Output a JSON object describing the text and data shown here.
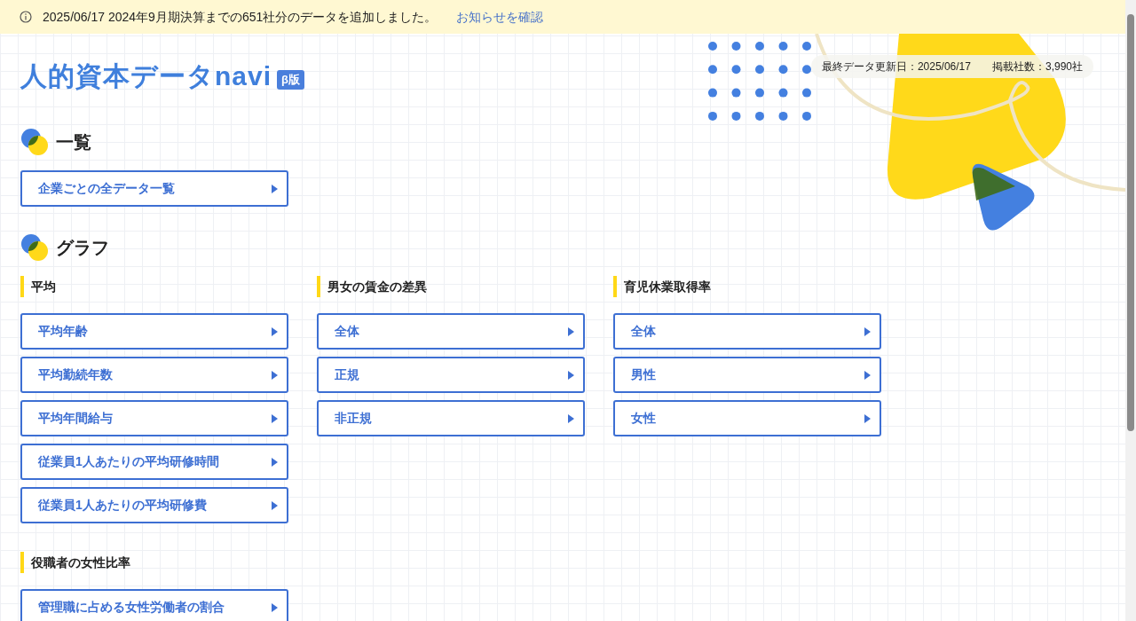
{
  "notice": {
    "text": "2025/06/17 2024年9月期決算までの651社分のデータを追加しました。",
    "link": "お知らせを確認"
  },
  "logo": {
    "text": "人的資本データnavi",
    "badge": "β版"
  },
  "stats": [
    {
      "text": "最終データ更新日：2025/06/17"
    },
    {
      "text": "掲載社数：3,990社"
    }
  ],
  "sections": [
    {
      "title": "一覧",
      "groups": [
        {
          "links": [
            "企業ごとの全データ一覧"
          ]
        }
      ]
    },
    {
      "title": "グラフ",
      "groups": [
        {
          "title": "平均",
          "links": [
            "平均年齢",
            "平均勤続年数",
            "平均年間給与",
            "従業員1人あたりの平均研修時間",
            "従業員1人あたりの平均研修費"
          ]
        },
        {
          "title": "男女の賃金の差異",
          "links": [
            "全体",
            "正規",
            "非正規"
          ]
        },
        {
          "title": "育児休業取得率",
          "links": [
            "全体",
            "男性",
            "女性"
          ]
        },
        {
          "title": "役職者の女性比率",
          "links": [
            "管理職に占める女性労働者の割合"
          ]
        }
      ]
    }
  ]
}
